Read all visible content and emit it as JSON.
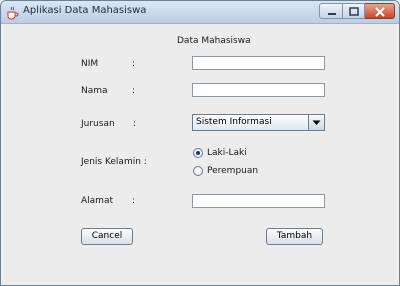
{
  "window": {
    "title": "Aplikasi Data Mahasiswa",
    "heading": "Data Mahasiswa"
  },
  "form": {
    "nim": {
      "label": "NIM",
      "colon": ":",
      "value": ""
    },
    "nama": {
      "label": "Nama",
      "colon": ":",
      "value": ""
    },
    "jurusan": {
      "label": "Jurusan",
      "colon": ":",
      "selected": "Sistem Informasi"
    },
    "jenis_kelamin": {
      "label": "Jenis Kelamin :",
      "options": [
        {
          "label": "Laki-Laki",
          "selected": true
        },
        {
          "label": "Perempuan",
          "selected": false
        }
      ]
    },
    "alamat": {
      "label": "Alamat",
      "colon": ":",
      "value": ""
    }
  },
  "buttons": {
    "cancel": "Cancel",
    "tambah": "Tambah"
  },
  "icons": {
    "app": "java-cup-icon",
    "minimize": "minimize-icon",
    "maximize": "maximize-icon",
    "close": "close-icon",
    "dropdown": "chevron-down-icon"
  }
}
